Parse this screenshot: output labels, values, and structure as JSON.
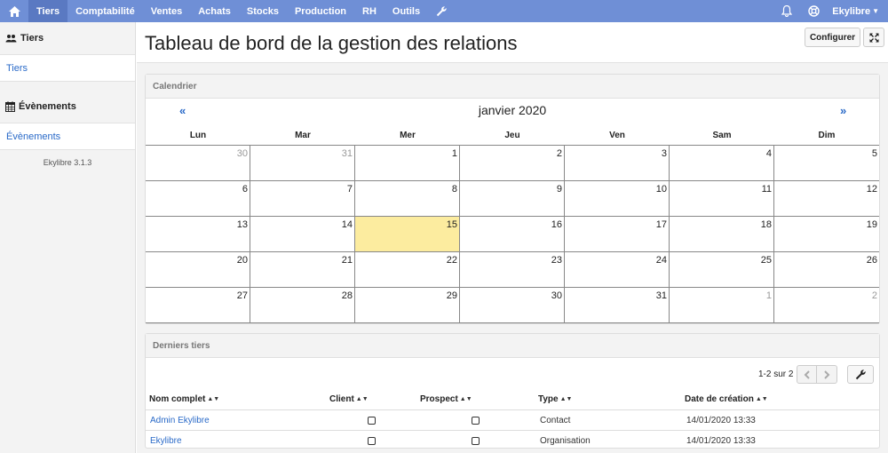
{
  "nav": {
    "items": [
      {
        "label": "Tiers",
        "active": true
      },
      {
        "label": "Comptabilité"
      },
      {
        "label": "Ventes"
      },
      {
        "label": "Achats"
      },
      {
        "label": "Stocks"
      },
      {
        "label": "Production"
      },
      {
        "label": "RH"
      },
      {
        "label": "Outils"
      }
    ],
    "user": "Ekylibre",
    "accent": "#6f8fd6"
  },
  "sidebar": {
    "sections": [
      {
        "title": "Tiers",
        "icon": "users-icon",
        "link": "Tiers"
      },
      {
        "title": "Évènements",
        "icon": "calendar-icon",
        "link": "Évènements"
      }
    ],
    "version": "Ekylibre 3.1.3"
  },
  "page": {
    "title": "Tableau de bord de la gestion des relations",
    "configure_label": "Configurer"
  },
  "calendar": {
    "panel_title": "Calendrier",
    "month": "janvier 2020",
    "prev": "«",
    "next": "»",
    "weekdays": [
      "Lun",
      "Mar",
      "Mer",
      "Jeu",
      "Ven",
      "Sam",
      "Dim"
    ],
    "days": [
      "30",
      "31",
      "1",
      "2",
      "3",
      "4",
      "5",
      "6",
      "7",
      "8",
      "9",
      "10",
      "11",
      "12",
      "13",
      "14",
      "15",
      "16",
      "17",
      "18",
      "19",
      "20",
      "21",
      "22",
      "23",
      "24",
      "25",
      "26",
      "27",
      "28",
      "29",
      "30",
      "31",
      "1",
      "2"
    ],
    "other_month": [
      0,
      1,
      33,
      34
    ],
    "today_index": 16,
    "today_color": "#fcec9f"
  },
  "tiers": {
    "panel_title": "Derniers tiers",
    "pagination": "1-2 sur 2",
    "columns": [
      "Nom complet",
      "Client",
      "Prospect",
      "Type",
      "Date de création"
    ],
    "rows": [
      {
        "name": "Admin Ekylibre",
        "client": false,
        "prospect": false,
        "type": "Contact",
        "created": "14/01/2020 13:33"
      },
      {
        "name": "Ekylibre",
        "client": false,
        "prospect": false,
        "type": "Organisation",
        "created": "14/01/2020 13:33"
      }
    ]
  }
}
